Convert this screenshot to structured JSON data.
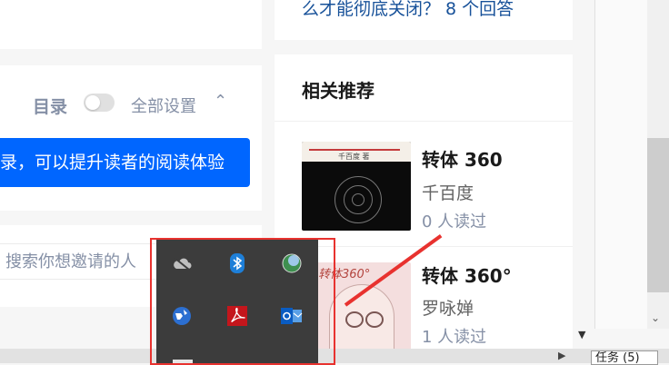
{
  "question": {
    "related_text": "么才能彻底关闭？ 8 个回答"
  },
  "editor": {
    "toc_label": "目录",
    "all_settings_label": "全部设置",
    "tip_text": "录，可以提升读者的阅读体验",
    "invite_placeholder": "搜索你想邀请的人"
  },
  "recommendations": {
    "title": "相关推荐",
    "items": [
      {
        "title": "转体 360",
        "author": "千百度",
        "readers": "0 人读过",
        "cover_author": "千百度 著"
      },
      {
        "title": "转体 360°",
        "author": "罗咏婵",
        "readers": "1 人读过",
        "cover_title": "转体360°"
      }
    ]
  },
  "taskbar": {
    "button_label": "任务 (5)"
  },
  "tray": {
    "icons": [
      "onedrive-icon",
      "bluetooth-icon",
      "network-globe-icon",
      "browser-globe-icon",
      "adobe-reader-icon",
      "outlook-icon"
    ]
  },
  "colors": {
    "accent": "#0066ff",
    "highlight": "#e8322f"
  }
}
